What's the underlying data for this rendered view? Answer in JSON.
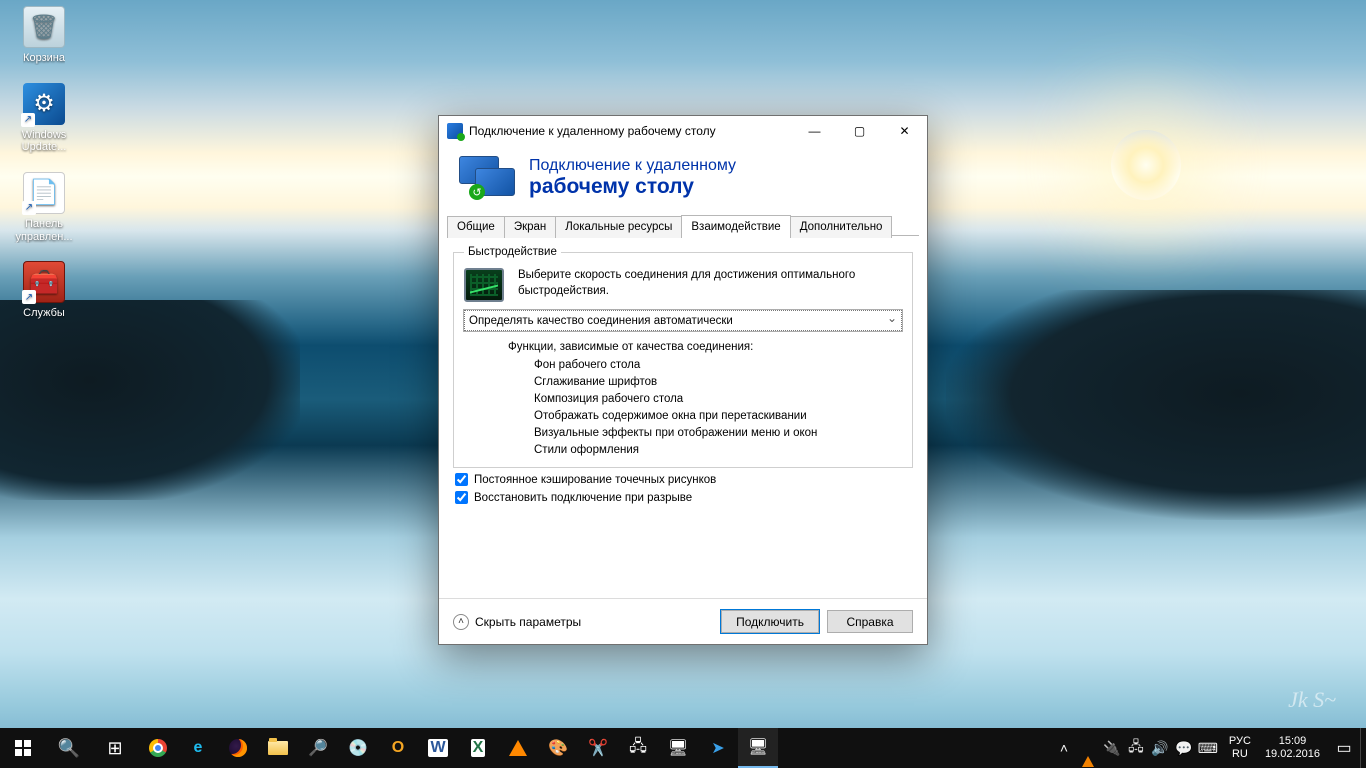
{
  "desktop": {
    "icons": [
      {
        "name": "recycle-bin",
        "label": "Корзина"
      },
      {
        "name": "windows-update",
        "label": "Windows Update..."
      },
      {
        "name": "control-panel",
        "label": "Панель управлен..."
      },
      {
        "name": "services",
        "label": "Службы"
      }
    ]
  },
  "window": {
    "title": "Подключение к удаленному рабочему столу",
    "banner_line1": "Подключение к удаленному",
    "banner_line2": "рабочему столу",
    "tabs": {
      "general": "Общие",
      "display": "Экран",
      "local": "Локальные ресурсы",
      "experience": "Взаимодействие",
      "advanced": "Дополнительно"
    },
    "group": {
      "legend": "Быстродействие",
      "hint": "Выберите скорость соединения для достижения оптимального быстродействия.",
      "combo_value": "Определять качество соединения автоматически",
      "funcs_header": "Функции, зависимые от качества соединения:",
      "funcs": [
        "Фон рабочего стола",
        "Сглаживание шрифтов",
        "Композиция рабочего стола",
        "Отображать содержимое окна при перетаскивании",
        "Визуальные эффекты при отображении меню и окон",
        "Стили оформления"
      ]
    },
    "check_cache": "Постоянное кэширование точечных рисунков",
    "check_reconnect": "Восстановить подключение при разрыве",
    "hide_options": "Скрыть параметры",
    "connect": "Подключить",
    "help": "Справка"
  },
  "tray": {
    "lang1": "РУС",
    "lang2": "RU",
    "time": "15:09",
    "date": "19.02.2016"
  }
}
